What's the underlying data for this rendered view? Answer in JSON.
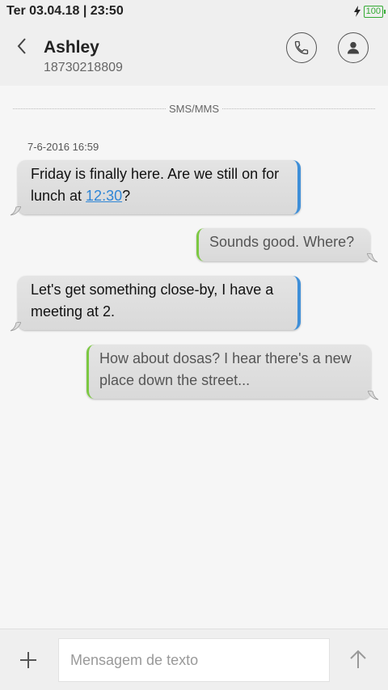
{
  "status_bar": {
    "datetime": "Ter 03.04.18 | 23:50",
    "battery": "100",
    "battery_color": "#33aa33"
  },
  "header": {
    "back_icon": "chevron-left-icon",
    "contact_name": "Ashley",
    "contact_number": "18730218809",
    "call_icon": "phone-icon",
    "profile_icon": "person-icon"
  },
  "thread": {
    "channel_label": "SMS/MMS",
    "timestamp": "7-6-2016 16:59",
    "messages": [
      {
        "direction": "incoming",
        "text_before": "Friday is finally here. Are we still on for lunch at ",
        "link": "12:30",
        "text_after": "?"
      },
      {
        "direction": "outgoing",
        "text": "Sounds good. Where?"
      },
      {
        "direction": "incoming",
        "text": "Let's get something close-by, I have a meeting at 2."
      },
      {
        "direction": "outgoing",
        "text": "How about dosas? I hear there's a new place down the street..."
      }
    ],
    "incoming_accent": "#3f8fd8",
    "outgoing_accent": "#7cc842"
  },
  "composer": {
    "placeholder": "Mensagem de texto",
    "value": "",
    "add_icon": "plus-icon",
    "send_icon": "arrow-up-icon"
  }
}
